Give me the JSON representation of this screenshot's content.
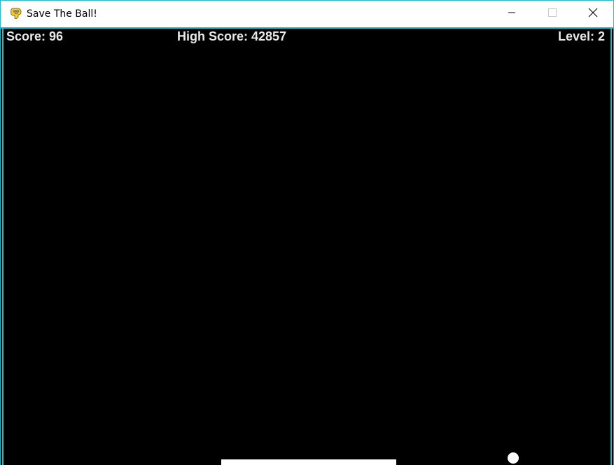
{
  "window": {
    "title": "Save The Ball!",
    "icon": "pygame-snake-icon",
    "controls": {
      "minimize_icon": "minimize-icon",
      "maximize_icon": "maximize-icon",
      "close_icon": "close-icon"
    },
    "border_color": "#2ab7c6"
  },
  "hud": {
    "score": "Score: 96",
    "high_score": "High Score: 42857",
    "level": "Level: 2",
    "text_color": "#e8e8e8"
  },
  "game": {
    "background_color": "#000000",
    "paddle_color": "#ffffff",
    "ball_color": "#ffffff"
  }
}
